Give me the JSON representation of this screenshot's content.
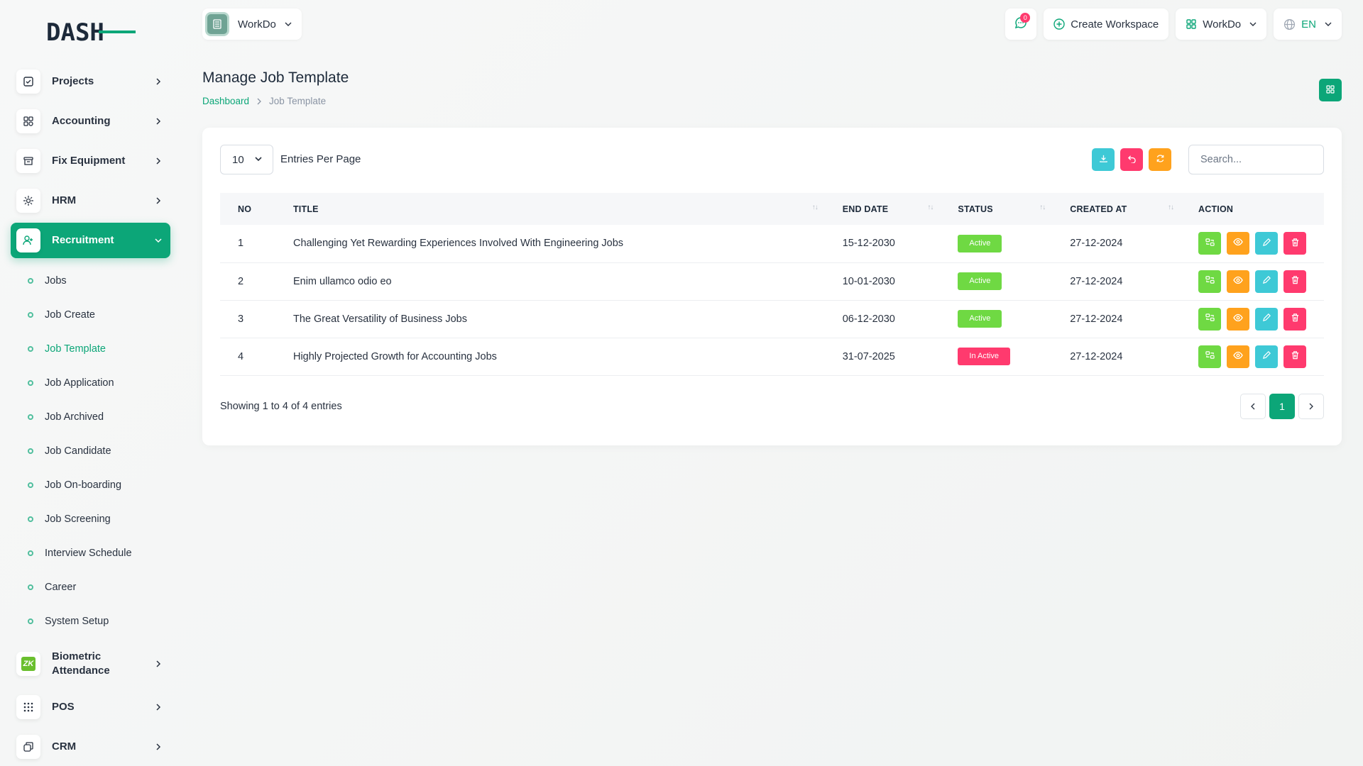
{
  "brand": {
    "logo_text": "DASH"
  },
  "sidebar": {
    "items": [
      {
        "label": "Projects",
        "icon": "checkbox-icon"
      },
      {
        "label": "Accounting",
        "icon": "grid-icon"
      },
      {
        "label": "Fix Equipment",
        "icon": "archive-icon"
      },
      {
        "label": "HRM",
        "icon": "hrm-icon"
      },
      {
        "label": "Recruitment",
        "icon": "user-plus-icon"
      }
    ],
    "recruitment_sub": [
      "Jobs",
      "Job Create",
      "Job Template",
      "Job Application",
      "Job Archived",
      "Job Candidate",
      "Job On-boarding",
      "Job Screening",
      "Interview Schedule",
      "Career",
      "System Setup"
    ],
    "bottom_items": [
      {
        "label_1": "Biometric",
        "label_2": "Attendance",
        "icon_text": "ZK"
      },
      {
        "label": "POS"
      },
      {
        "label": "CRM"
      }
    ]
  },
  "header": {
    "workspace": "WorkDo",
    "message_count": "0",
    "create_workspace": "Create Workspace",
    "workspace_menu": "WorkDo",
    "language": "EN"
  },
  "page": {
    "title": "Manage Job Template",
    "breadcrumb_home": "Dashboard",
    "breadcrumb_current": "Job Template"
  },
  "table": {
    "per_page": "10",
    "per_page_label": "Entries Per Page",
    "search_placeholder": "Search...",
    "headers": [
      "NO",
      "TITLE",
      "END DATE",
      "STATUS",
      "CREATED AT",
      "ACTION"
    ],
    "rows": [
      {
        "no": "1",
        "title": "Challenging Yet Rewarding Experiences Involved With Engineering Jobs",
        "end_date": "15-12-2030",
        "status": "Active",
        "created_at": "27-12-2024"
      },
      {
        "no": "2",
        "title": "Enim ullamco odio eo",
        "end_date": "10-01-2030",
        "status": "Active",
        "created_at": "27-12-2024"
      },
      {
        "no": "3",
        "title": "The Great Versatility of Business Jobs",
        "end_date": "06-12-2030",
        "status": "Active",
        "created_at": "27-12-2024"
      },
      {
        "no": "4",
        "title": "Highly Projected Growth for Accounting Jobs",
        "end_date": "31-07-2025",
        "status": "In Active",
        "created_at": "27-12-2024"
      }
    ],
    "showing": "Showing 1 to 4 of 4 entries",
    "current_page": "1"
  },
  "colors": {
    "primary": "#0ca678",
    "active_status": "#6fd943",
    "inactive_status": "#ff3a6e",
    "warning": "#ffa21d",
    "info": "#3ec9d6"
  }
}
